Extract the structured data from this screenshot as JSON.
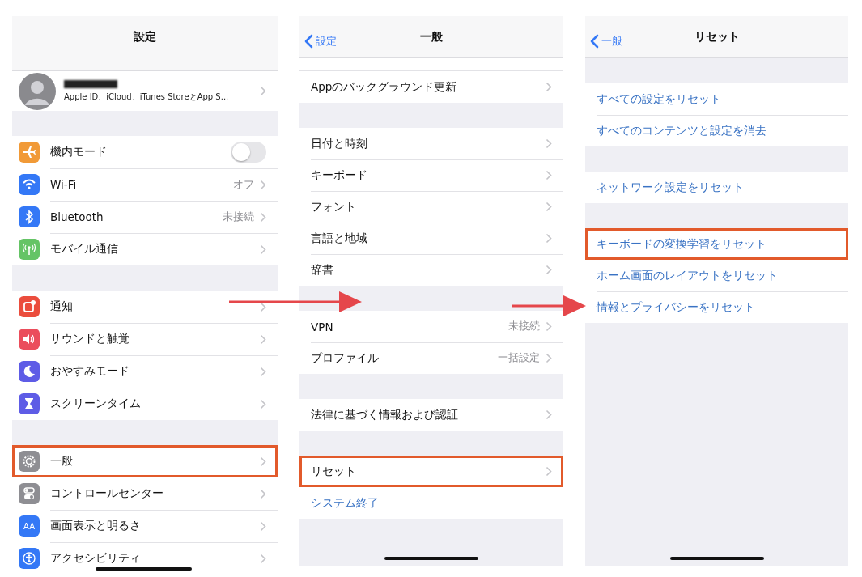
{
  "panels": [
    {
      "title": "設定",
      "sections": [
        {
          "rows": [
            {
              "kind": "profile",
              "label": "Apple ID、iCloud、iTunes StoreとApp S...",
              "highlighted": false
            }
          ]
        },
        {
          "rows": [
            {
              "kind": "toggle",
              "label": "機内モード",
              "color": "#f19a37",
              "on": false,
              "highlighted": false
            },
            {
              "kind": "link",
              "label": "Wi-Fi",
              "value": "オフ",
              "color": "#3478f6",
              "highlighted": false
            },
            {
              "kind": "link",
              "label": "Bluetooth",
              "value": "未接続",
              "color": "#3478f6",
              "highlighted": false
            },
            {
              "kind": "link",
              "label": "モバイル通信",
              "color": "#65c466",
              "highlighted": false
            }
          ]
        },
        {
          "rows": [
            {
              "kind": "link",
              "label": "通知",
              "color": "#eb4d3d",
              "highlighted": false
            },
            {
              "kind": "link",
              "label": "サウンドと触覚",
              "color": "#eb4d5c",
              "highlighted": false
            },
            {
              "kind": "link",
              "label": "おやすみモード",
              "color": "#5e5ce6",
              "highlighted": false
            },
            {
              "kind": "link",
              "label": "スクリーンタイム",
              "color": "#5e5ce6",
              "highlighted": false
            }
          ]
        },
        {
          "rows": [
            {
              "kind": "link",
              "label": "一般",
              "color": "#8e8e93",
              "highlighted": true
            },
            {
              "kind": "link",
              "label": "コントロールセンター",
              "color": "#8e8e93",
              "highlighted": false
            },
            {
              "kind": "link",
              "label": "画面表示と明るさ",
              "color": "#3478f6",
              "icon_text": "AA",
              "highlighted": false
            },
            {
              "kind": "link",
              "label": "アクセシビリティ",
              "color": "#3478f6",
              "highlighted": false
            }
          ]
        }
      ]
    },
    {
      "title": "一般",
      "back": "設定",
      "scrolled_under_header": true,
      "sections": [
        {
          "rows": [
            {
              "kind": "link",
              "label": "Appのバックグラウンド更新",
              "highlighted": false
            }
          ]
        },
        {
          "rows": [
            {
              "kind": "link",
              "label": "日付と時刻",
              "highlighted": false
            },
            {
              "kind": "link",
              "label": "キーボード",
              "highlighted": false
            },
            {
              "kind": "link",
              "label": "フォント",
              "highlighted": false
            },
            {
              "kind": "link",
              "label": "言語と地域",
              "highlighted": false
            },
            {
              "kind": "link",
              "label": "辞書",
              "highlighted": false
            }
          ]
        },
        {
          "rows": [
            {
              "kind": "link",
              "label": "VPN",
              "value": "未接続",
              "highlighted": false
            },
            {
              "kind": "link",
              "label": "プロファイル",
              "value": "一括設定",
              "highlighted": false
            }
          ]
        },
        {
          "rows": [
            {
              "kind": "link",
              "label": "法律に基づく情報および認証",
              "highlighted": false
            }
          ]
        },
        {
          "rows": [
            {
              "kind": "link",
              "label": "リセット",
              "highlighted": true
            },
            {
              "kind": "action",
              "label": "システム終了",
              "highlighted": false
            }
          ]
        }
      ]
    },
    {
      "title": "リセット",
      "back": "一般",
      "sections": [
        {
          "rows": [
            {
              "kind": "action",
              "label": "すべての設定をリセット",
              "highlighted": false
            },
            {
              "kind": "action",
              "label": "すべてのコンテンツと設定を消去",
              "highlighted": false
            }
          ]
        },
        {
          "rows": [
            {
              "kind": "action",
              "label": "ネットワーク設定をリセット",
              "highlighted": false
            }
          ]
        },
        {
          "rows": [
            {
              "kind": "action",
              "label": "キーボードの変換学習をリセット",
              "highlighted": true
            },
            {
              "kind": "action",
              "label": "ホーム画面のレイアウトをリセット",
              "highlighted": false
            },
            {
              "kind": "action",
              "label": "情報とプライバシーをリセット",
              "highlighted": false
            }
          ]
        }
      ]
    }
  ]
}
